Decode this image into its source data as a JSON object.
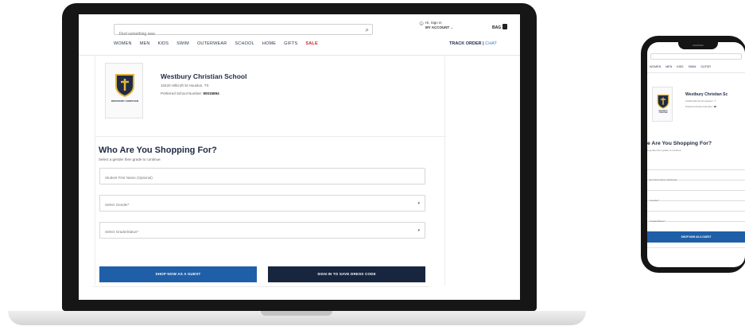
{
  "header": {
    "search_placeholder": "Find something new",
    "account_greeting": "Hi, Sign in",
    "account_label": "MY ACCOUNT",
    "bag_label": "BAG",
    "nav": [
      "WOMEN",
      "MEN",
      "KIDS",
      "SWIM",
      "OUTERWEAR",
      "SCHOOL",
      "HOME",
      "GIFTS",
      "SALE"
    ],
    "track_order": "TRACK ORDER",
    "chat": "CHAT"
  },
  "school": {
    "name": "Westbury Christian School",
    "address": "10420 Hillcroft St Houston, TX",
    "number_label": "Preferred School Number:",
    "number_value": "90015894",
    "crest_text": "WESTBURY CHRISTIAN"
  },
  "form": {
    "heading": "Who Are You Shopping For?",
    "subheading": "Select a gender then grade to continue.",
    "name_placeholder": "Student First Name (Optional)",
    "gender_placeholder": "Select Gender*",
    "grade_placeholder": "Select Grade/Status*",
    "guest_button": "SHOP NOW AS A GUEST",
    "signin_button": "SIGN IN TO SAVE DRESS CODE"
  },
  "mobile": {
    "nav": [
      "WOMEN",
      "MEN",
      "KIDS",
      "SWIM",
      "OUTER"
    ],
    "school_name": "Westbury Christian Sc",
    "school_address": "10420 Hillcroft St Houston, T",
    "school_number_label": "Preferred School Number:",
    "school_number_value": "90",
    "heading": "e Are You Shopping For?",
    "subheading": "a gender then grade to continue.",
    "name_placeholder": "dent First Name (Optional)",
    "gender_placeholder": "t Gender*",
    "grade_placeholder": "t Grade/Status*",
    "guest_button": "SHOP NOW AS A GUEST"
  },
  "colors": {
    "navy": "#17253f",
    "blue": "#1f5fa8",
    "sale_red": "#d0242b",
    "crest_gold": "#e2b43b"
  }
}
